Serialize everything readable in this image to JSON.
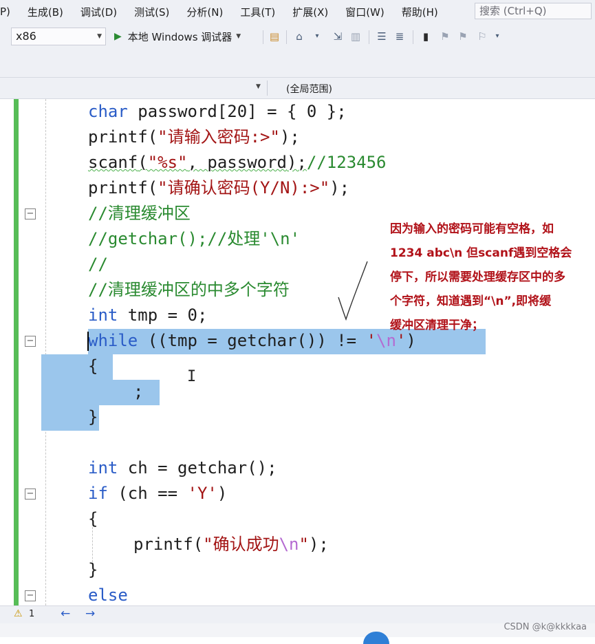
{
  "menu": {
    "items": [
      "P)",
      "生成(B)",
      "调试(D)",
      "测试(S)",
      "分析(N)",
      "工具(T)",
      "扩展(X)",
      "窗口(W)",
      "帮助(H)"
    ],
    "search_placeholder": "搜索 (Ctrl+Q)"
  },
  "toolbar": {
    "platform": "x86",
    "debugger_label": "本地 Windows 调试器"
  },
  "navbar": {
    "scope": "(全局范围)"
  },
  "code": {
    "l1": [
      "char",
      " password[20] = { 0 };"
    ],
    "l2": [
      "printf",
      "(",
      "\"请输入密码:>\"",
      ");"
    ],
    "l3": [
      "scanf",
      "(",
      "\"%s\"",
      ", password",
      ");",
      "//123456"
    ],
    "l4": [
      "printf",
      "(",
      "\"请确认密码(Y/N):>\"",
      ");"
    ],
    "l5": "//清理缓冲区",
    "l6": "//getchar();//处理'\\n'",
    "l7": "//",
    "l8": "//清理缓冲区的中多个字符",
    "l9": [
      "int",
      " tmp = 0;"
    ],
    "l10": [
      "while",
      " ((tmp = getchar()) != ",
      "'",
      "\\n",
      "'",
      ")"
    ],
    "l11": "{",
    "l12": ";",
    "l13": "}",
    "l14": [
      "int",
      " ch = getchar();"
    ],
    "l15": [
      "if",
      " (ch == ",
      "'Y'",
      ")"
    ],
    "l16": "{",
    "l17": [
      "printf",
      "(",
      "\"确认成功",
      "\\n",
      "\"",
      ");"
    ],
    "l18": "}",
    "l19": "else"
  },
  "annotation": {
    "lines": [
      "因为输入的密码可能有空格，如",
      "1234  abc\\n 但scanf遇到空格会",
      "停下，所以需要处理缓存区中的多",
      "个字符，知道遇到“\\n”,即将缓",
      "缓冲区清理干净；"
    ]
  },
  "status": {
    "warning_count": "1"
  },
  "watermark": "CSDN @k@kkkkaa",
  "colors": {
    "keyword": "#2a5cc7",
    "string": "#a31515",
    "comment": "#2a8a30",
    "selection": "#9bc6ec",
    "change_bar": "#57bd57",
    "annotation": "#b11219"
  }
}
